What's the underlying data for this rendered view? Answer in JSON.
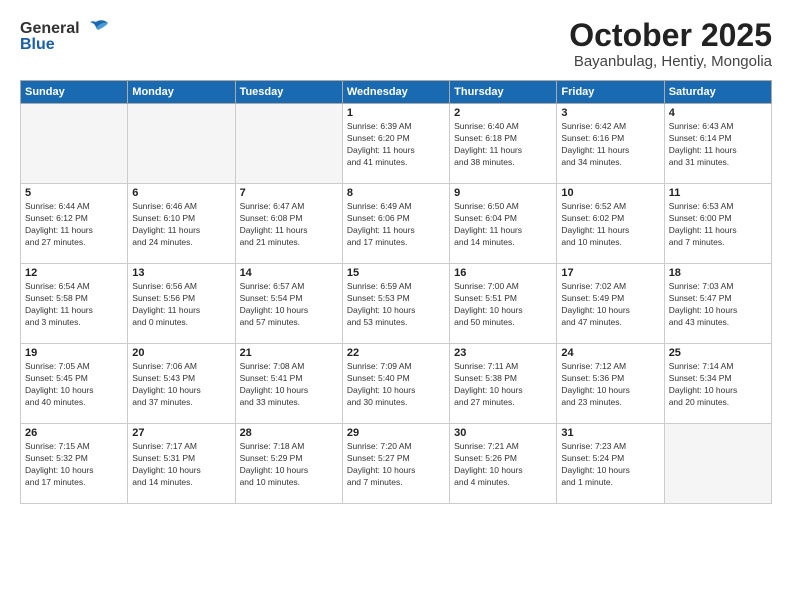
{
  "header": {
    "logo_general": "General",
    "logo_blue": "Blue",
    "title": "October 2025",
    "location": "Bayanbulag, Hentiy, Mongolia"
  },
  "weekdays": [
    "Sunday",
    "Monday",
    "Tuesday",
    "Wednesday",
    "Thursday",
    "Friday",
    "Saturday"
  ],
  "weeks": [
    [
      {
        "day": "",
        "info": ""
      },
      {
        "day": "",
        "info": ""
      },
      {
        "day": "",
        "info": ""
      },
      {
        "day": "1",
        "info": "Sunrise: 6:39 AM\nSunset: 6:20 PM\nDaylight: 11 hours\nand 41 minutes."
      },
      {
        "day": "2",
        "info": "Sunrise: 6:40 AM\nSunset: 6:18 PM\nDaylight: 11 hours\nand 38 minutes."
      },
      {
        "day": "3",
        "info": "Sunrise: 6:42 AM\nSunset: 6:16 PM\nDaylight: 11 hours\nand 34 minutes."
      },
      {
        "day": "4",
        "info": "Sunrise: 6:43 AM\nSunset: 6:14 PM\nDaylight: 11 hours\nand 31 minutes."
      }
    ],
    [
      {
        "day": "5",
        "info": "Sunrise: 6:44 AM\nSunset: 6:12 PM\nDaylight: 11 hours\nand 27 minutes."
      },
      {
        "day": "6",
        "info": "Sunrise: 6:46 AM\nSunset: 6:10 PM\nDaylight: 11 hours\nand 24 minutes."
      },
      {
        "day": "7",
        "info": "Sunrise: 6:47 AM\nSunset: 6:08 PM\nDaylight: 11 hours\nand 21 minutes."
      },
      {
        "day": "8",
        "info": "Sunrise: 6:49 AM\nSunset: 6:06 PM\nDaylight: 11 hours\nand 17 minutes."
      },
      {
        "day": "9",
        "info": "Sunrise: 6:50 AM\nSunset: 6:04 PM\nDaylight: 11 hours\nand 14 minutes."
      },
      {
        "day": "10",
        "info": "Sunrise: 6:52 AM\nSunset: 6:02 PM\nDaylight: 11 hours\nand 10 minutes."
      },
      {
        "day": "11",
        "info": "Sunrise: 6:53 AM\nSunset: 6:00 PM\nDaylight: 11 hours\nand 7 minutes."
      }
    ],
    [
      {
        "day": "12",
        "info": "Sunrise: 6:54 AM\nSunset: 5:58 PM\nDaylight: 11 hours\nand 3 minutes."
      },
      {
        "day": "13",
        "info": "Sunrise: 6:56 AM\nSunset: 5:56 PM\nDaylight: 11 hours\nand 0 minutes."
      },
      {
        "day": "14",
        "info": "Sunrise: 6:57 AM\nSunset: 5:54 PM\nDaylight: 10 hours\nand 57 minutes."
      },
      {
        "day": "15",
        "info": "Sunrise: 6:59 AM\nSunset: 5:53 PM\nDaylight: 10 hours\nand 53 minutes."
      },
      {
        "day": "16",
        "info": "Sunrise: 7:00 AM\nSunset: 5:51 PM\nDaylight: 10 hours\nand 50 minutes."
      },
      {
        "day": "17",
        "info": "Sunrise: 7:02 AM\nSunset: 5:49 PM\nDaylight: 10 hours\nand 47 minutes."
      },
      {
        "day": "18",
        "info": "Sunrise: 7:03 AM\nSunset: 5:47 PM\nDaylight: 10 hours\nand 43 minutes."
      }
    ],
    [
      {
        "day": "19",
        "info": "Sunrise: 7:05 AM\nSunset: 5:45 PM\nDaylight: 10 hours\nand 40 minutes."
      },
      {
        "day": "20",
        "info": "Sunrise: 7:06 AM\nSunset: 5:43 PM\nDaylight: 10 hours\nand 37 minutes."
      },
      {
        "day": "21",
        "info": "Sunrise: 7:08 AM\nSunset: 5:41 PM\nDaylight: 10 hours\nand 33 minutes."
      },
      {
        "day": "22",
        "info": "Sunrise: 7:09 AM\nSunset: 5:40 PM\nDaylight: 10 hours\nand 30 minutes."
      },
      {
        "day": "23",
        "info": "Sunrise: 7:11 AM\nSunset: 5:38 PM\nDaylight: 10 hours\nand 27 minutes."
      },
      {
        "day": "24",
        "info": "Sunrise: 7:12 AM\nSunset: 5:36 PM\nDaylight: 10 hours\nand 23 minutes."
      },
      {
        "day": "25",
        "info": "Sunrise: 7:14 AM\nSunset: 5:34 PM\nDaylight: 10 hours\nand 20 minutes."
      }
    ],
    [
      {
        "day": "26",
        "info": "Sunrise: 7:15 AM\nSunset: 5:32 PM\nDaylight: 10 hours\nand 17 minutes."
      },
      {
        "day": "27",
        "info": "Sunrise: 7:17 AM\nSunset: 5:31 PM\nDaylight: 10 hours\nand 14 minutes."
      },
      {
        "day": "28",
        "info": "Sunrise: 7:18 AM\nSunset: 5:29 PM\nDaylight: 10 hours\nand 10 minutes."
      },
      {
        "day": "29",
        "info": "Sunrise: 7:20 AM\nSunset: 5:27 PM\nDaylight: 10 hours\nand 7 minutes."
      },
      {
        "day": "30",
        "info": "Sunrise: 7:21 AM\nSunset: 5:26 PM\nDaylight: 10 hours\nand 4 minutes."
      },
      {
        "day": "31",
        "info": "Sunrise: 7:23 AM\nSunset: 5:24 PM\nDaylight: 10 hours\nand 1 minute."
      },
      {
        "day": "",
        "info": ""
      }
    ]
  ]
}
